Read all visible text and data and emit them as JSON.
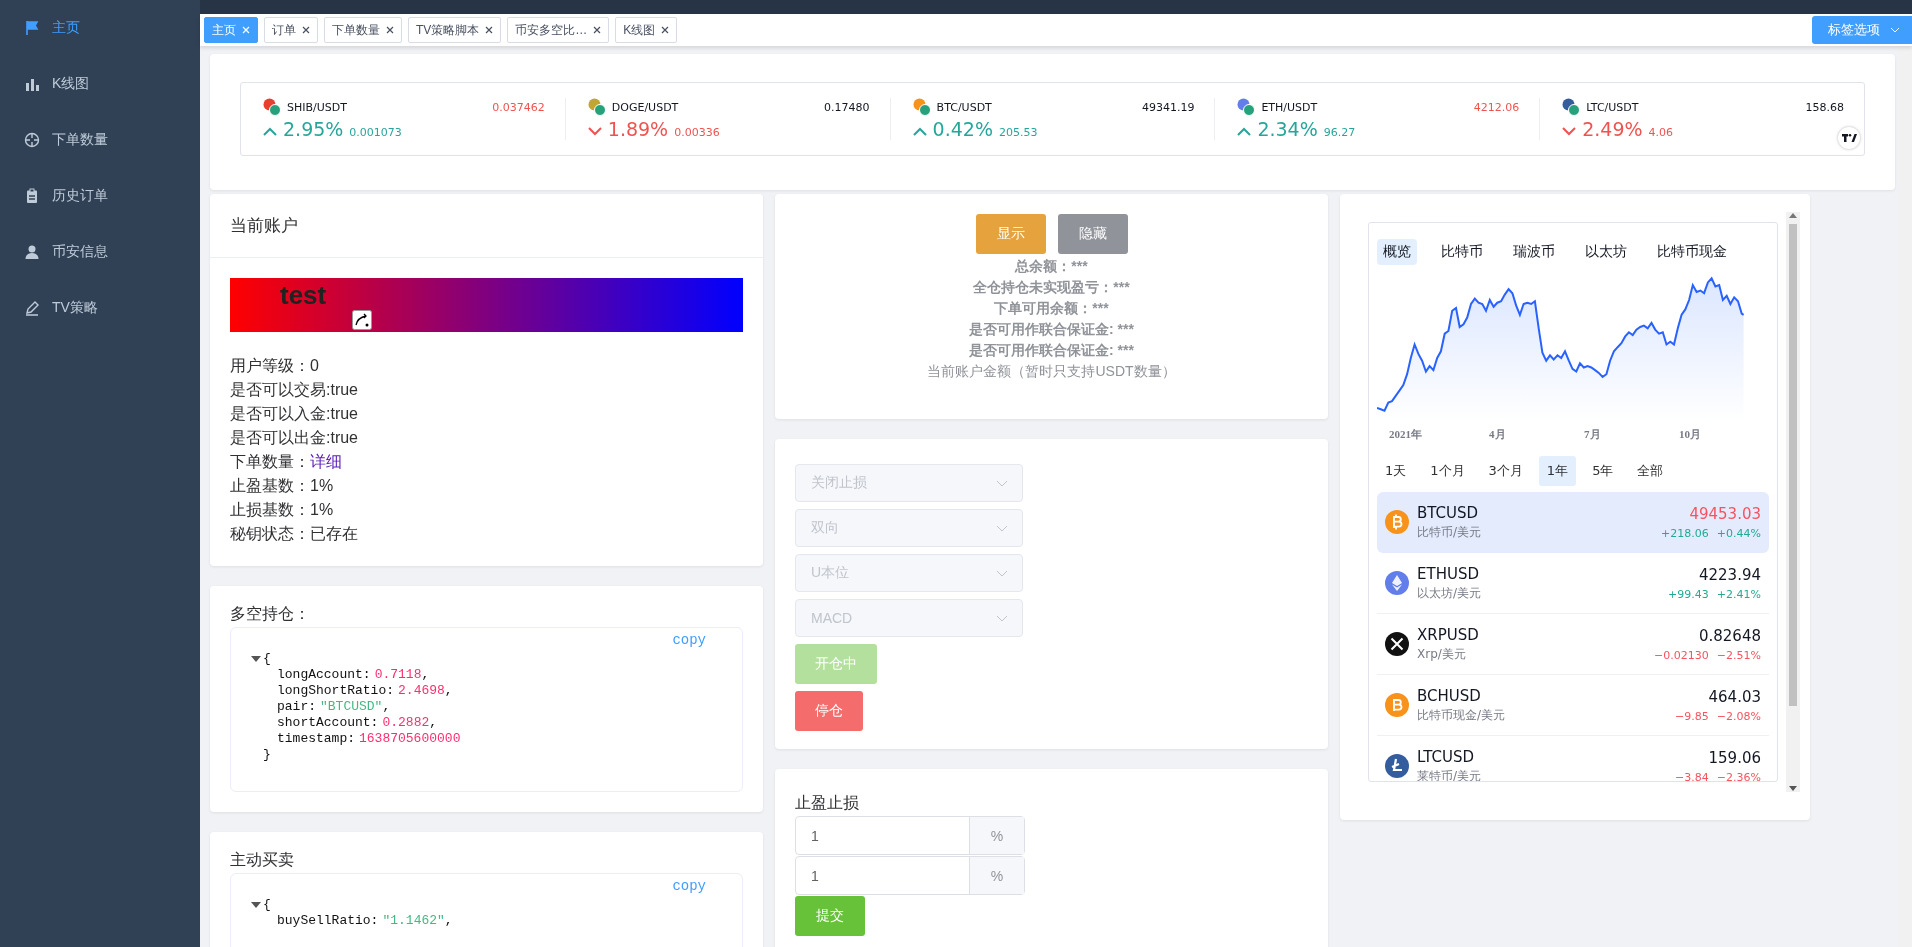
{
  "sidebar": {
    "items": [
      {
        "label": "主页",
        "selected": true
      },
      {
        "label": "K线图",
        "selected": false
      },
      {
        "label": "下单数量",
        "selected": false
      },
      {
        "label": "历史订单",
        "selected": false
      },
      {
        "label": "币安信息",
        "selected": false
      },
      {
        "label": "TV策略",
        "selected": false
      }
    ]
  },
  "tabs": [
    {
      "label": "主页",
      "selected": true
    },
    {
      "label": "订单",
      "selected": false
    },
    {
      "label": "下单数量",
      "selected": false
    },
    {
      "label": "TV策略脚本",
      "selected": false
    },
    {
      "label": "币安多空比…",
      "selected": false
    },
    {
      "label": "K线图",
      "selected": false
    }
  ],
  "tab_options_button": "标签选项",
  "ticker": [
    {
      "pair": "SHIB/USDT",
      "price": "0.037462",
      "price_down": true,
      "change_pct": "2.95%",
      "change": "0.001073",
      "rising": true
    },
    {
      "pair": "DOGE/USDT",
      "price": "0.17480",
      "price_down": false,
      "change_pct": "1.89%",
      "change": "0.00336",
      "rising": false
    },
    {
      "pair": "BTC/USDT",
      "price": "49341.19",
      "price_down": false,
      "change_pct": "0.42%",
      "change": "205.53",
      "rising": true
    },
    {
      "pair": "ETH/USDT",
      "price": "4212.06",
      "price_down": true,
      "change_pct": "2.34%",
      "change": "96.27",
      "rising": true
    },
    {
      "pair": "LTC/USDT",
      "price": "158.68",
      "price_down": false,
      "change_pct": "2.49%",
      "change": "4.06",
      "rising": false
    }
  ],
  "account": {
    "title": "当前账户",
    "banner_name": "test",
    "rows": [
      {
        "text": "用户等级：0"
      },
      {
        "text": "是否可以交易:true"
      },
      {
        "text": "是否可以入金:true"
      },
      {
        "text": "是否可以出金:true"
      },
      {
        "text": "下单数量：",
        "link": "详细"
      },
      {
        "text": "止盈基数：1%"
      },
      {
        "text": "止损基数：1%"
      },
      {
        "text": "秘钥状态：已存在"
      }
    ]
  },
  "json_cards": [
    {
      "title": "多空持仓：",
      "copy": "copy",
      "open": "{",
      "close": "}",
      "lines": [
        {
          "key": "longAccount:",
          "value": "0.7118",
          "kind": "number",
          "tail": ","
        },
        {
          "key": "longShortRatio:",
          "value": "2.4698",
          "kind": "number",
          "tail": ","
        },
        {
          "key": "pair:",
          "value": "\"BTCUSD\"",
          "kind": "string",
          "tail": ","
        },
        {
          "key": "shortAccount:",
          "value": "0.2882",
          "kind": "number",
          "tail": ","
        },
        {
          "key": "timestamp:",
          "value": "1638705600000",
          "kind": "number"
        }
      ]
    },
    {
      "title": "主动买卖",
      "copy": "copy",
      "open": "{",
      "lines": [
        {
          "key": "buySellRatio:",
          "value": "\"1.1462\"",
          "kind": "string",
          "tail": ","
        }
      ]
    }
  ],
  "balance": {
    "buttons": [
      {
        "label": "显示",
        "kind": "warning"
      },
      {
        "label": "隐藏",
        "kind": "info"
      }
    ],
    "lines": [
      "总余额：***",
      "全仓持仓未实现盈亏：***",
      "下单可用余额：***",
      "是否可用作联合保证金: ***",
      "是否可用作联合保证金: ***"
    ],
    "note": "当前账户金额（暂时只支持USDT数量）"
  },
  "strategy": {
    "selects": [
      {
        "value": "关闭止损",
        "disabled": true
      },
      {
        "value": "双向",
        "disabled": true
      },
      {
        "value": "U本位",
        "disabled": true
      },
      {
        "value": "MACD",
        "disabled": true
      }
    ],
    "buttons": [
      {
        "label": "开仓中",
        "kind": "success",
        "disabled": true
      },
      {
        "label": "停仓",
        "kind": "danger",
        "disabled": false
      }
    ]
  },
  "tp_sl": {
    "title": "止盈止损",
    "inputs": [
      {
        "value": "1",
        "unit": "%"
      },
      {
        "value": "1",
        "unit": "%"
      }
    ],
    "submit": "提交"
  },
  "market": {
    "tabs": [
      {
        "label": "概览",
        "selected": true
      },
      {
        "label": "比特币",
        "selected": false
      },
      {
        "label": "瑞波币",
        "selected": false
      },
      {
        "label": "以太坊",
        "selected": false
      },
      {
        "label": "比特币现金",
        "selected": false
      }
    ],
    "x_labels": [
      "2021年",
      "4月",
      "7月",
      "10月"
    ],
    "ranges": [
      {
        "label": "1天",
        "selected": false
      },
      {
        "label": "1个月",
        "selected": false
      },
      {
        "label": "3个月",
        "selected": false
      },
      {
        "label": "1年",
        "selected": true
      },
      {
        "label": "5年",
        "selected": false
      },
      {
        "label": "全部",
        "selected": false
      }
    ],
    "symbols": [
      {
        "symbol": "BTCUSD",
        "name": "比特币/美元",
        "price": "49453.03",
        "price_down": true,
        "change": "+218.06",
        "change_pct": "+0.44%",
        "rising": true,
        "selected": true
      },
      {
        "symbol": "ETHUSD",
        "name": "以太坊/美元",
        "price": "4223.94",
        "price_down": false,
        "change": "+99.43",
        "change_pct": "+2.41%",
        "rising": true,
        "selected": false
      },
      {
        "symbol": "XRPUSD",
        "name": "Xrp/美元",
        "price": "0.82648",
        "price_down": false,
        "change": "−0.02130",
        "change_pct": "−2.51%",
        "rising": false,
        "selected": false
      },
      {
        "symbol": "BCHUSD",
        "name": "比特币现金/美元",
        "price": "464.03",
        "price_down": false,
        "change": "−9.85",
        "change_pct": "−2.08%",
        "rising": false,
        "selected": false
      },
      {
        "symbol": "LTCUSD",
        "name": "莱特币/美元",
        "price": "159.06",
        "price_down": false,
        "change": "−3.84",
        "change_pct": "−2.36%",
        "rising": false,
        "selected": false
      }
    ]
  }
}
